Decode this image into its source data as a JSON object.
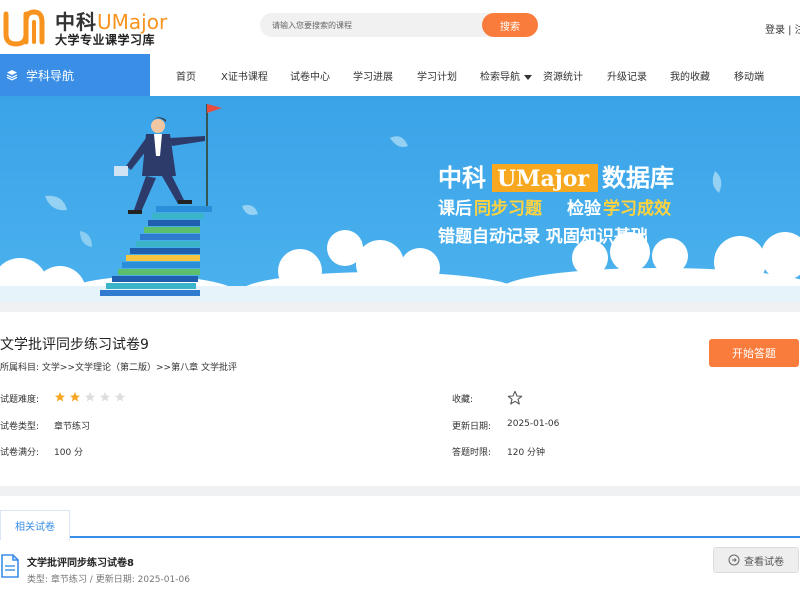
{
  "brand": {
    "name_cn": "中科",
    "name_en": "UMajor",
    "tagline": "大学专业课学习库",
    "accent": "#f7931e"
  },
  "search": {
    "placeholder": "请输入您要搜索的课程",
    "button": "搜索"
  },
  "auth": {
    "login": "登录",
    "separator": " | ",
    "register": "注"
  },
  "nav": {
    "subject_nav": "学科导航",
    "items": [
      "首页",
      "X证书课程",
      "试卷中心",
      "学习进展",
      "学习计划",
      "检索导航",
      "资源统计",
      "升级记录",
      "我的收藏",
      "移动端"
    ]
  },
  "banner": {
    "title_pre": "中科",
    "title_highlight": "UMajor",
    "title_post": "数据库",
    "line2_a": "课后",
    "line2_b": "同步习题",
    "line2_c": "检验",
    "line2_d": "学习成效",
    "line3": "错题自动记录 巩固知识基础"
  },
  "paper": {
    "title": "文学批评同步练习试卷9",
    "subject_label": "所属科目:",
    "subject_path": "文学>>文学理论（第二版）>>第八章 文学批评",
    "start_button": "开始答题",
    "difficulty_label": "试题难度:",
    "difficulty_rating": 2,
    "difficulty_max": 5,
    "favorite_label": "收藏:",
    "type_label": "试卷类型:",
    "type_value": "章节练习",
    "updated_label": "更新日期:",
    "updated_value": "2025-01-06",
    "score_label": "试卷满分:",
    "score_value": "100 分",
    "time_label": "答题时限:",
    "time_value": "120 分钟"
  },
  "related": {
    "tab": "相关试卷",
    "items": [
      {
        "title": "文学批评同步练习试卷8",
        "type_label": "类型:",
        "type_value": "章节练习",
        "sep": " / ",
        "date_label": "更新日期:",
        "date_value": "2025-01-06",
        "button": "查看试卷"
      }
    ]
  },
  "colors": {
    "primary": "#3a8ee6",
    "orange": "#f97c3c",
    "star_on": "#f5a623",
    "star_off": "#dddddd",
    "banner_bg": "#3aa3e8"
  },
  "icons": [
    "logo-mark",
    "layers-icon",
    "chevron-down-icon",
    "star-icon",
    "star-outline-icon",
    "document-icon",
    "arrow-circle-icon"
  ]
}
